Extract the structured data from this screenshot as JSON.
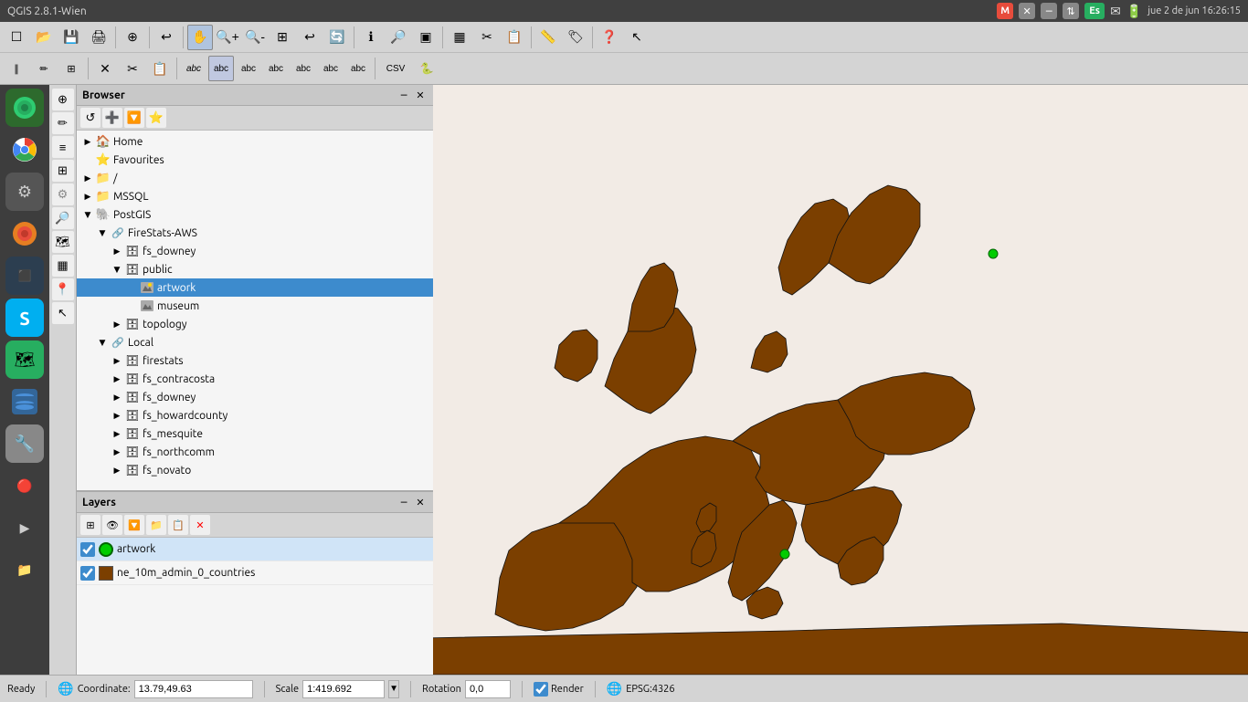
{
  "titlebar": {
    "title": "QGIS 2.8.1-Wien",
    "controls": {
      "minimize": "─",
      "maximize": "□",
      "close": "✕"
    }
  },
  "system_tray": {
    "m_icon": "M",
    "x_icon": "✕",
    "minus_icon": "─",
    "arrows_icon": "⇅",
    "es_icon": "Es",
    "mail_icon": "✉",
    "battery_icon": "🔋",
    "time": "jue 2 de jun 16:26:15"
  },
  "toolbar1": {
    "buttons": [
      "☐",
      "📂",
      "💾",
      "🖨",
      "⊕",
      "🔍",
      "🔎",
      "🔍",
      "↩",
      "🔄",
      "🖱",
      "ℹ",
      "🔎",
      "➕",
      "🗺",
      "🗺",
      "🔲",
      "🖊",
      "✂",
      "📋",
      "📏",
      "🏷",
      "❓",
      "↖"
    ]
  },
  "toolbar2": {
    "buttons": [
      "∥",
      "✏",
      "⊞",
      "≡",
      "✕",
      "🔲",
      "🏷",
      "abc",
      "abc",
      "abc",
      "abc",
      "abc",
      "abc",
      "CSV",
      "🐍"
    ]
  },
  "browser": {
    "title": "Browser",
    "toolbar_buttons": [
      "↺",
      "➕",
      "🔽",
      "⭐"
    ],
    "tree": [
      {
        "id": "home",
        "label": "Home",
        "indent": 0,
        "icon": "🏠",
        "expanded": false,
        "toggle": "▶"
      },
      {
        "id": "favourites",
        "label": "Favourites",
        "indent": 0,
        "icon": "⭐",
        "expanded": false,
        "toggle": ""
      },
      {
        "id": "root",
        "label": "/",
        "indent": 0,
        "icon": "📁",
        "expanded": false,
        "toggle": "▶"
      },
      {
        "id": "mssql",
        "label": "MSSQL",
        "indent": 0,
        "icon": "📁",
        "expanded": false,
        "toggle": "▶"
      },
      {
        "id": "postgis",
        "label": "PostGIS",
        "indent": 0,
        "icon": "🔷",
        "expanded": true,
        "toggle": "▼"
      },
      {
        "id": "firestats-aws",
        "label": "FireStats-AWS",
        "indent": 1,
        "icon": "🔗",
        "expanded": true,
        "toggle": "▼"
      },
      {
        "id": "fs_downey",
        "label": "fs_downey",
        "indent": 2,
        "icon": "🗄",
        "expanded": false,
        "toggle": "▶"
      },
      {
        "id": "public",
        "label": "public",
        "indent": 2,
        "icon": "📂",
        "expanded": true,
        "toggle": "▼"
      },
      {
        "id": "artwork",
        "label": "artwork",
        "indent": 3,
        "icon": "📊",
        "expanded": false,
        "toggle": "",
        "selected": true
      },
      {
        "id": "museum",
        "label": "museum",
        "indent": 3,
        "icon": "📊",
        "expanded": false,
        "toggle": ""
      },
      {
        "id": "topology",
        "label": "topology",
        "indent": 2,
        "icon": "📂",
        "expanded": false,
        "toggle": "▶"
      },
      {
        "id": "local",
        "label": "Local",
        "indent": 1,
        "icon": "🔗",
        "expanded": true,
        "toggle": "▼"
      },
      {
        "id": "firestats",
        "label": "firestats",
        "indent": 2,
        "icon": "🗄",
        "expanded": false,
        "toggle": "▶"
      },
      {
        "id": "fs_contracosta",
        "label": "fs_contracosta",
        "indent": 2,
        "icon": "🗄",
        "expanded": false,
        "toggle": "▶"
      },
      {
        "id": "fs_downey2",
        "label": "fs_downey",
        "indent": 2,
        "icon": "🗄",
        "expanded": false,
        "toggle": "▶"
      },
      {
        "id": "fs_howardcounty",
        "label": "fs_howardcounty",
        "indent": 2,
        "icon": "🗄",
        "expanded": false,
        "toggle": "▶"
      },
      {
        "id": "fs_mesquite",
        "label": "fs_mesquite",
        "indent": 2,
        "icon": "🗄",
        "expanded": false,
        "toggle": "▶"
      },
      {
        "id": "fs_northcomm",
        "label": "fs_northcomm",
        "indent": 2,
        "icon": "🗄",
        "expanded": false,
        "toggle": "▶"
      },
      {
        "id": "fs_novato",
        "label": "fs_novato",
        "indent": 2,
        "icon": "🗄",
        "expanded": false,
        "toggle": "▶"
      }
    ]
  },
  "layers": {
    "title": "Layers",
    "items": [
      {
        "id": "artwork-layer",
        "name": "artwork",
        "type": "point",
        "color": "#00b300",
        "checked": true
      },
      {
        "id": "countries-layer",
        "name": "ne_10m_admin_0_countries",
        "type": "fill",
        "color": "#7b3f00",
        "checked": true
      }
    ]
  },
  "statusbar": {
    "ready": "Ready",
    "coordinate_label": "Coordinate:",
    "coordinate_value": "13.79,49.63",
    "scale_label": "Scale",
    "scale_value": "1:419.692",
    "rotation_label": "Rotation",
    "rotation_value": "0,0",
    "render_label": "Render",
    "epsg_label": "EPSG:4326"
  },
  "app_icons": [
    {
      "id": "qgis",
      "icon": "🌐",
      "color": "#2ecc71"
    },
    {
      "id": "chrome",
      "icon": "🔵",
      "color": "#4285f4"
    },
    {
      "id": "settings",
      "icon": "⚙",
      "color": "#888"
    },
    {
      "id": "firefox",
      "icon": "🦊",
      "color": "#e67e22"
    },
    {
      "id": "terminal",
      "icon": "⬛",
      "color": "#2c3e50"
    },
    {
      "id": "skype",
      "icon": "S",
      "color": "#00aff0"
    },
    {
      "id": "maps",
      "icon": "🗺",
      "color": "#27ae60"
    },
    {
      "id": "db",
      "icon": "🐘",
      "color": "#336699"
    },
    {
      "id": "tools",
      "icon": "🔧",
      "color": "#95a5a6"
    },
    {
      "id": "ytp",
      "icon": "▶",
      "color": "#e74c3c"
    }
  ]
}
